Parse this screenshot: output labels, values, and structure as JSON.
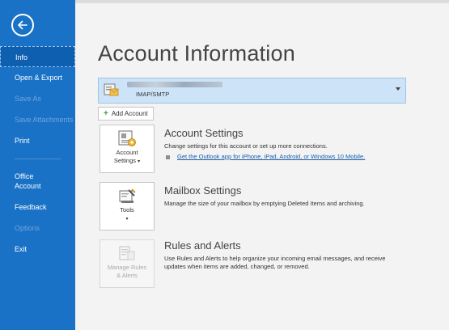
{
  "sidebar": {
    "items": [
      {
        "label": "Info",
        "state": "active"
      },
      {
        "label": "Open & Export",
        "state": "normal"
      },
      {
        "label": "Save As",
        "state": "disabled"
      },
      {
        "label": "Save Attachments",
        "state": "disabled"
      },
      {
        "label": "Print",
        "state": "normal"
      },
      {
        "label": "Office Account",
        "state": "normal"
      },
      {
        "label": "Feedback",
        "state": "normal"
      },
      {
        "label": "Options",
        "state": "disabled"
      },
      {
        "label": "Exit",
        "state": "normal"
      }
    ]
  },
  "main": {
    "title": "Account Information",
    "account": {
      "type": "IMAP/SMTP"
    },
    "add_account_label": "Add Account",
    "sections": {
      "account_settings": {
        "tile_line1": "Account",
        "tile_line2": "Settings",
        "tile_caret": "▾",
        "title": "Account Settings",
        "description": "Change settings for this account or set up more connections.",
        "link": "Get the Outlook app for iPhone, iPad, Android, or Windows 10 Mobile."
      },
      "mailbox_settings": {
        "tile_line1": "Tools",
        "tile_caret": "▾",
        "title": "Mailbox Settings",
        "description": "Manage the size of your mailbox by emptying Deleted Items and archiving."
      },
      "rules_alerts": {
        "tile_line1": "Manage Rules",
        "tile_line2": "& Alerts",
        "title": "Rules and Alerts",
        "description": "Use Rules and Alerts to help organize your incoming email messages, and receive updates when items are added, changed, or removed."
      }
    }
  },
  "colors": {
    "sidebar": "#1a72c7",
    "sidebar_active": "#0f5fb0",
    "account_bar": "#cde3f7",
    "link": "#1a5ea8"
  },
  "icons": [
    "back-arrow-icon",
    "account-icon",
    "plus-icon",
    "account-settings-icon",
    "tools-icon",
    "rules-icon",
    "dropdown-arrow-icon"
  ]
}
